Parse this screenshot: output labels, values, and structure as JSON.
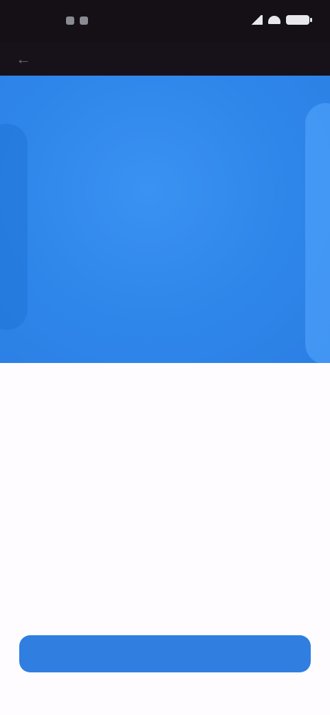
{
  "status_bar": {
    "time": "",
    "left_icons": [
      "notification-icon",
      "notification-icon"
    ],
    "right_icons": [
      "signal-icon",
      "wifi-icon",
      "battery-icon"
    ]
  },
  "app_bar": {
    "back_glyph": "←"
  },
  "hero": {
    "title": ""
  },
  "card": {
    "heading": "",
    "body": ""
  },
  "actions": {
    "primary_label": ""
  },
  "colors": {
    "status_bar_bg": "#141016",
    "hero_bg": "#2f86ea",
    "card_bg": "#fefcff",
    "button_bg": "#2f7ee0"
  }
}
